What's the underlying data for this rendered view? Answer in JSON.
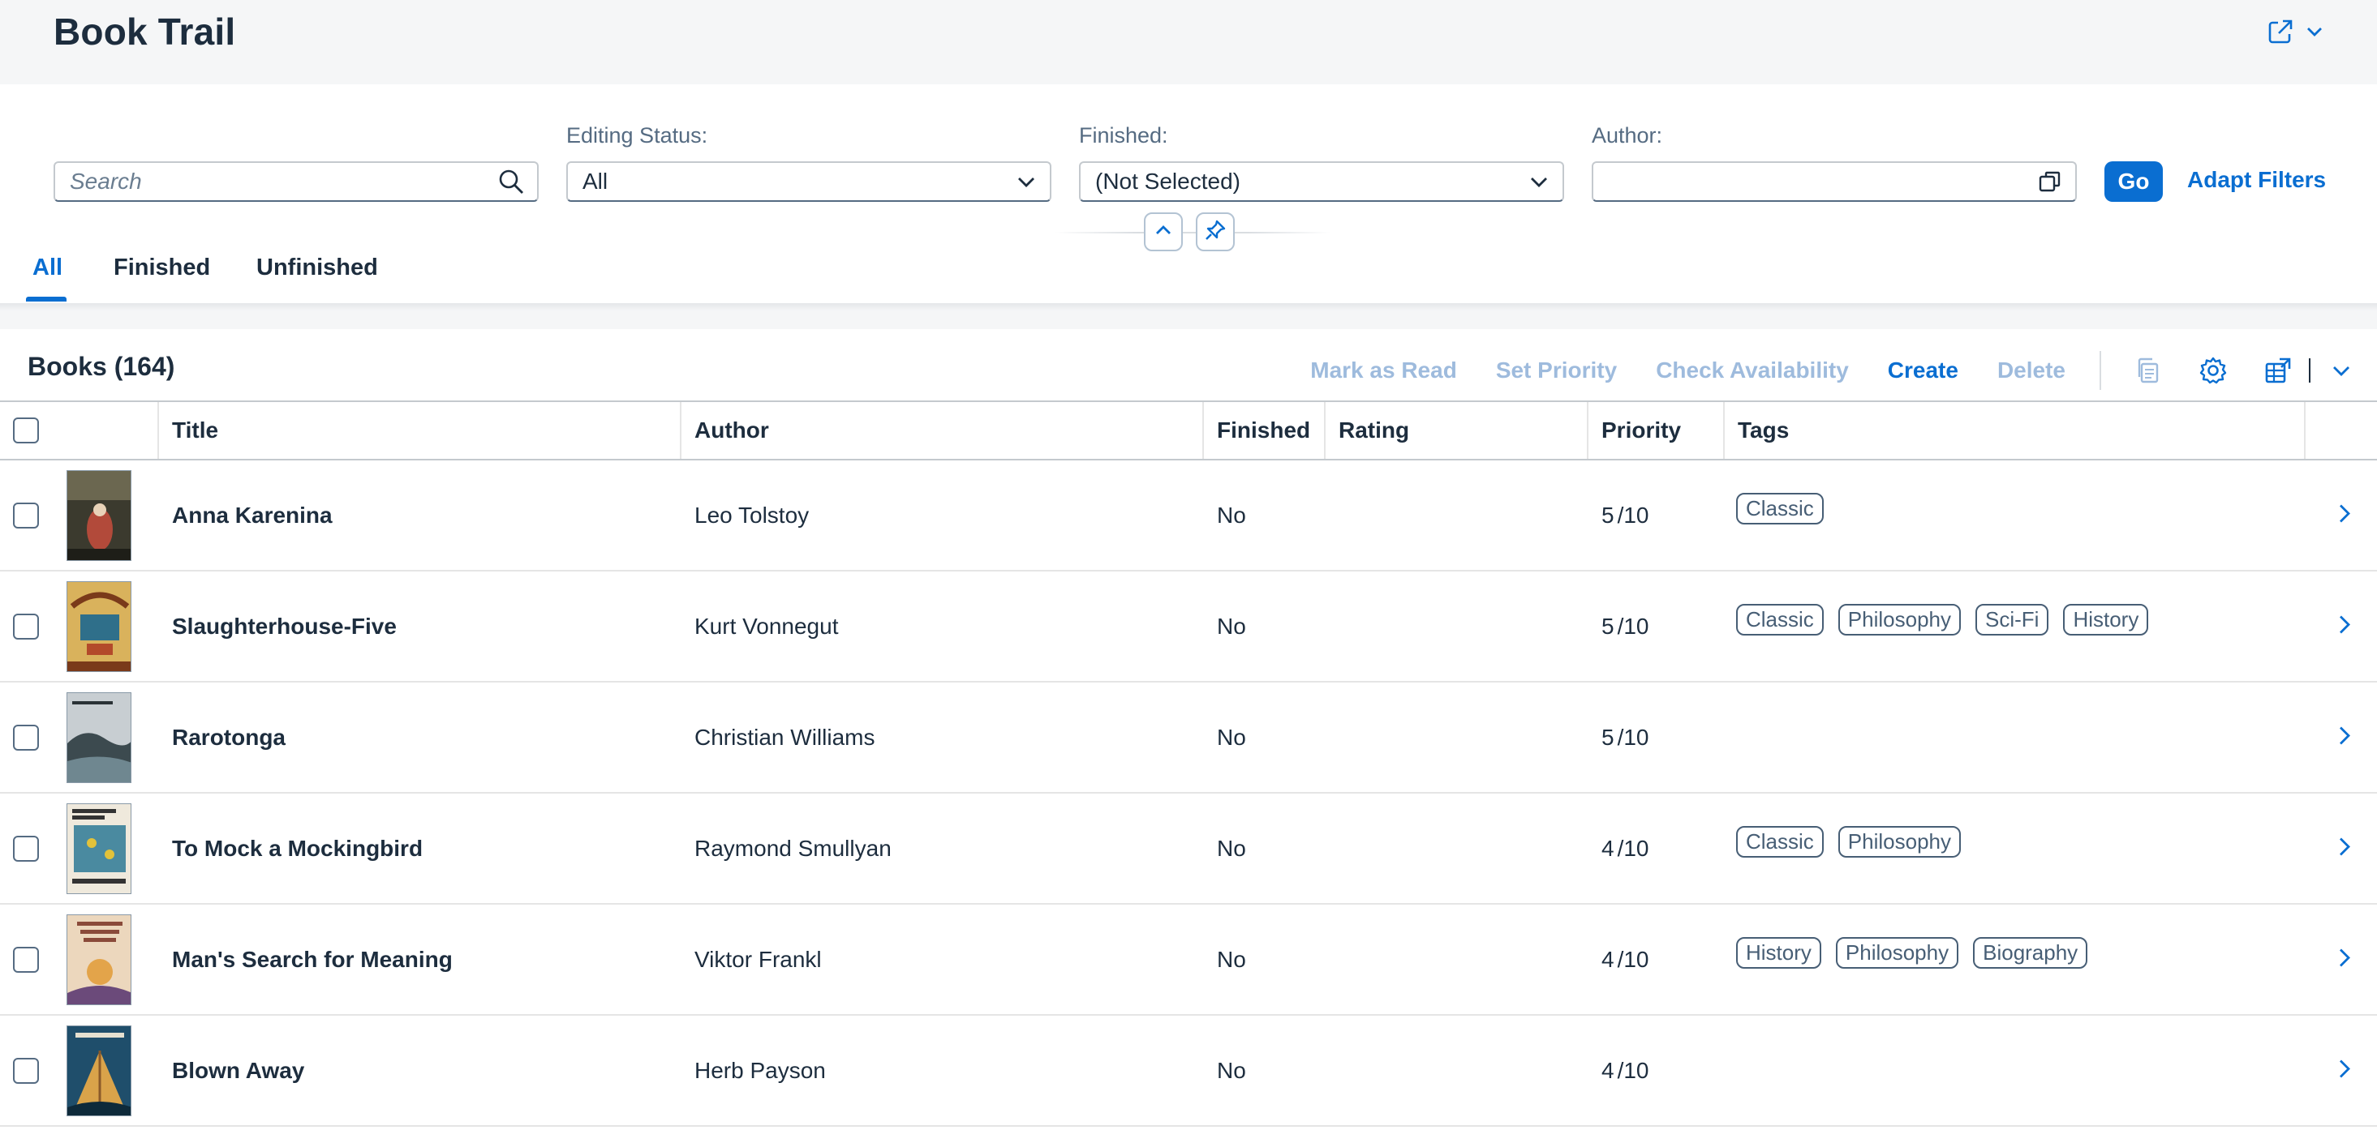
{
  "app": {
    "title": "Book Trail"
  },
  "filters": {
    "search_placeholder": "Search",
    "editing_status": {
      "label": "Editing Status:",
      "value": "All"
    },
    "finished": {
      "label": "Finished:",
      "value": "(Not Selected)"
    },
    "author": {
      "label": "Author:",
      "value": ""
    },
    "go_label": "Go",
    "adapt_label": "Adapt Filters"
  },
  "tabs": [
    {
      "label": "All",
      "active": true
    },
    {
      "label": "Finished",
      "active": false
    },
    {
      "label": "Unfinished",
      "active": false
    }
  ],
  "table": {
    "title": "Books (164)",
    "toolbar": {
      "mark_read": "Mark as Read",
      "set_priority": "Set Priority",
      "check_availability": "Check Availability",
      "create": "Create",
      "delete": "Delete"
    },
    "columns": {
      "title": "Title",
      "author": "Author",
      "finished": "Finished",
      "rating": "Rating",
      "priority": "Priority",
      "tags": "Tags"
    },
    "rows": [
      {
        "title": "Anna Karenina",
        "author": "Leo Tolstoy",
        "finished": "No",
        "rating": "",
        "priority": "5",
        "priority_max": "/10",
        "tags": [
          "Classic"
        ]
      },
      {
        "title": "Slaughterhouse-Five",
        "author": "Kurt Vonnegut",
        "finished": "No",
        "rating": "",
        "priority": "5",
        "priority_max": "/10",
        "tags": [
          "Classic",
          "Philosophy",
          "Sci-Fi",
          "History"
        ]
      },
      {
        "title": "Rarotonga",
        "author": "Christian Williams",
        "finished": "No",
        "rating": "",
        "priority": "5",
        "priority_max": "/10",
        "tags": []
      },
      {
        "title": "To Mock a Mockingbird",
        "author": "Raymond Smullyan",
        "finished": "No",
        "rating": "",
        "priority": "4",
        "priority_max": "/10",
        "tags": [
          "Classic",
          "Philosophy"
        ]
      },
      {
        "title": "Man's Search for Meaning",
        "author": "Viktor Frankl",
        "finished": "No",
        "rating": "",
        "priority": "4",
        "priority_max": "/10",
        "tags": [
          "History",
          "Philosophy",
          "Biography"
        ]
      },
      {
        "title": "Blown Away",
        "author": "Herb Payson",
        "finished": "No",
        "rating": "",
        "priority": "4",
        "priority_max": "/10",
        "tags": []
      }
    ]
  },
  "colors": {
    "accent": "#0a6ed1",
    "disabled_action": "#9ebbdd",
    "header_bg": "#f5f6f7",
    "text": "#1d2d3e"
  },
  "icons": {
    "header": [
      "share-icon",
      "chevron-down-icon"
    ],
    "search": "search-icon",
    "author_help": "value-help-icon",
    "collapse": "chevron-up-icon",
    "pin": "pin-icon",
    "toolbar": [
      "copy-icon",
      "settings-icon",
      "export-icon",
      "chevron-down-icon"
    ],
    "row_nav": "chevron-right-icon"
  }
}
